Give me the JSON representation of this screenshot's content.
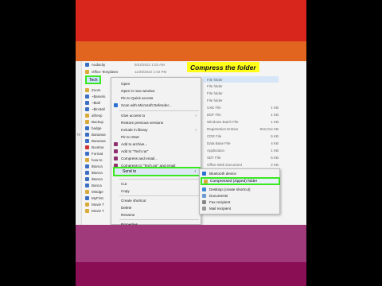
{
  "caption": "Compress the folder",
  "selected_file": "Tech",
  "files": [
    {
      "name": "Audacity",
      "date": "9/24/2022 1:02 AM",
      "icon": "shortcut-icon"
    },
    {
      "name": "Office Templates",
      "date": "11/25/2022 1:02 PM",
      "icon": "folder-icon"
    },
    {
      "name": "Tech",
      "date": "",
      "icon": "folder-icon"
    },
    {
      "name": "Zoom",
      "date": "",
      "icon": "folder-icon"
    },
    {
      "name": "~$amelo",
      "date": "",
      "icon": "doc-icon"
    },
    {
      "name": "~$tall",
      "date": "",
      "icon": "doc-icon"
    },
    {
      "name": "~$install",
      "date": "",
      "icon": "doc-icon"
    },
    {
      "name": "alfresp",
      "date": "",
      "icon": "file-icon"
    },
    {
      "name": "Backup",
      "date": "",
      "icon": "file-icon"
    },
    {
      "name": "badge",
      "date": "",
      "icon": "file-icon"
    },
    {
      "name": "Bananas",
      "date": "",
      "icon": "file-icon"
    },
    {
      "name": "Bananas",
      "date": "",
      "icon": "file-icon"
    },
    {
      "name": "Bootme",
      "date": "",
      "icon": "file-icon"
    },
    {
      "name": "Format",
      "date": "",
      "icon": "file-icon"
    },
    {
      "name": "how-to",
      "date": "",
      "icon": "file-icon"
    },
    {
      "name": "iBanca",
      "date": "",
      "icon": "file-icon"
    },
    {
      "name": "iBanca",
      "date": "",
      "icon": "file-icon"
    },
    {
      "name": "iBanca",
      "date": "",
      "icon": "file-icon"
    },
    {
      "name": "Banca",
      "date": "",
      "icon": "file-icon"
    },
    {
      "name": "Mindge",
      "date": "",
      "icon": "file-icon"
    },
    {
      "name": "MyFirst",
      "date": "",
      "icon": "file-icon"
    },
    {
      "name": "Movie T",
      "date": "",
      "icon": "file-icon"
    },
    {
      "name": "Movie T",
      "date": "",
      "icon": "file-icon"
    }
  ],
  "file_types": [
    {
      "type": "File folder",
      "size": ""
    },
    {
      "type": "File folder",
      "size": ""
    },
    {
      "type": "File folder",
      "size": ""
    },
    {
      "type": "File folder",
      "size": ""
    },
    {
      "type": "UXE File",
      "size": "1 KB"
    },
    {
      "type": "DDF File",
      "size": "1 KB"
    },
    {
      "type": "Windows Batch File",
      "size": "1 KB"
    },
    {
      "type": "Registration Entries",
      "size": "842,014 KB"
    },
    {
      "type": "CDR File",
      "size": "6 KB"
    },
    {
      "type": "Data Base File",
      "size": "4 KB"
    },
    {
      "type": "Application",
      "size": "1 KB"
    },
    {
      "type": "SDT File",
      "size": "6 KB"
    },
    {
      "type": "Office Web Document",
      "size": "2 KB"
    },
    {
      "type": "Microsoft Excel Works",
      "size": "1 KB"
    },
    {
      "type": "Text Document",
      "size": "1 KB"
    }
  ],
  "context_menu": {
    "items": [
      {
        "label": "Open",
        "icon": "",
        "arrow": false
      },
      {
        "label": "Open in new window",
        "icon": "",
        "arrow": false
      },
      {
        "label": "Pin to Quick access",
        "icon": "",
        "arrow": false
      },
      {
        "label": "Scan with Microsoft Defender...",
        "icon": "shield-icon",
        "arrow": false
      },
      {
        "label": "Give access to",
        "icon": "",
        "arrow": true
      },
      {
        "label": "Restore previous versions",
        "icon": "",
        "arrow": false
      },
      {
        "label": "Include in library",
        "icon": "",
        "arrow": true
      },
      {
        "label": "Pin to Start",
        "icon": "",
        "arrow": false
      },
      {
        "label": "Add to archive...",
        "icon": "winrar-icon",
        "arrow": false
      },
      {
        "label": "Add to \"Tech.rar\"",
        "icon": "winrar-icon",
        "arrow": false
      },
      {
        "label": "Compress and email...",
        "icon": "winrar-icon",
        "arrow": false
      },
      {
        "label": "Compress to \"Tech.rar\" and email",
        "icon": "winrar-icon",
        "arrow": false
      }
    ],
    "send_to_label": "Send to",
    "items_after": [
      {
        "label": "Cut"
      },
      {
        "label": "Copy"
      },
      {
        "label": "Create shortcut"
      },
      {
        "label": "Delete"
      },
      {
        "label": "Rename"
      },
      {
        "label": "Properties"
      }
    ]
  },
  "send_to_menu": {
    "top_item": "Bluetooth device",
    "compressed_label": "Compressed (zipped) folder",
    "items": [
      "Desktop (create shortcut)",
      "Documents",
      "Fax recipient",
      "Mail recipient"
    ]
  },
  "side_number": "70",
  "colors": {
    "band_top": "#d8261d",
    "band_orange": "#e2651f",
    "band_mauve": "#a13a7a",
    "band_bottom": "#8a0e54",
    "highlight_outline": "#39e81f",
    "caption_bg": "#ffff1a"
  }
}
